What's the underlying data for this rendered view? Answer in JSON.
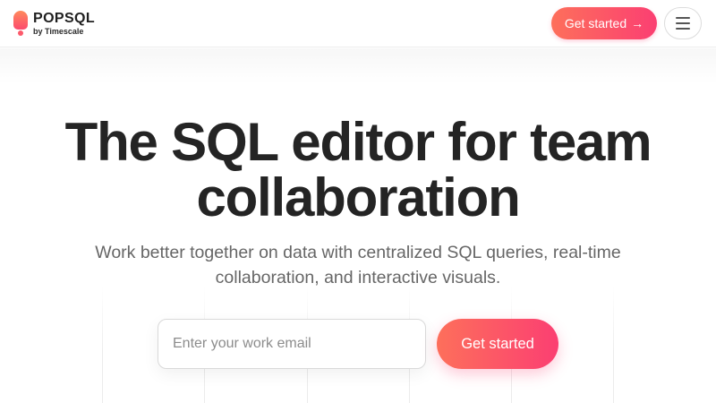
{
  "header": {
    "logo_name": "POPSQL",
    "logo_sub": "by Timescale",
    "cta_label": "Get started",
    "cta_icon": "arrow-right-icon",
    "cta_arrow": "→",
    "menu_icon": "hamburger-menu-icon"
  },
  "hero": {
    "title_line1": "The SQL editor for team",
    "title_line2": "collaboration",
    "subtitle_line1": "Work better together on data with centralized SQL queries, real-time",
    "subtitle_line2": "collaboration, and interactive visuals.",
    "email_placeholder": "Enter your work email",
    "cta_label": "Get started"
  },
  "colors": {
    "accent_start": "#fd6f5b",
    "accent_end": "#fb3f72",
    "text_dark": "#242424",
    "text_muted": "#666666"
  }
}
